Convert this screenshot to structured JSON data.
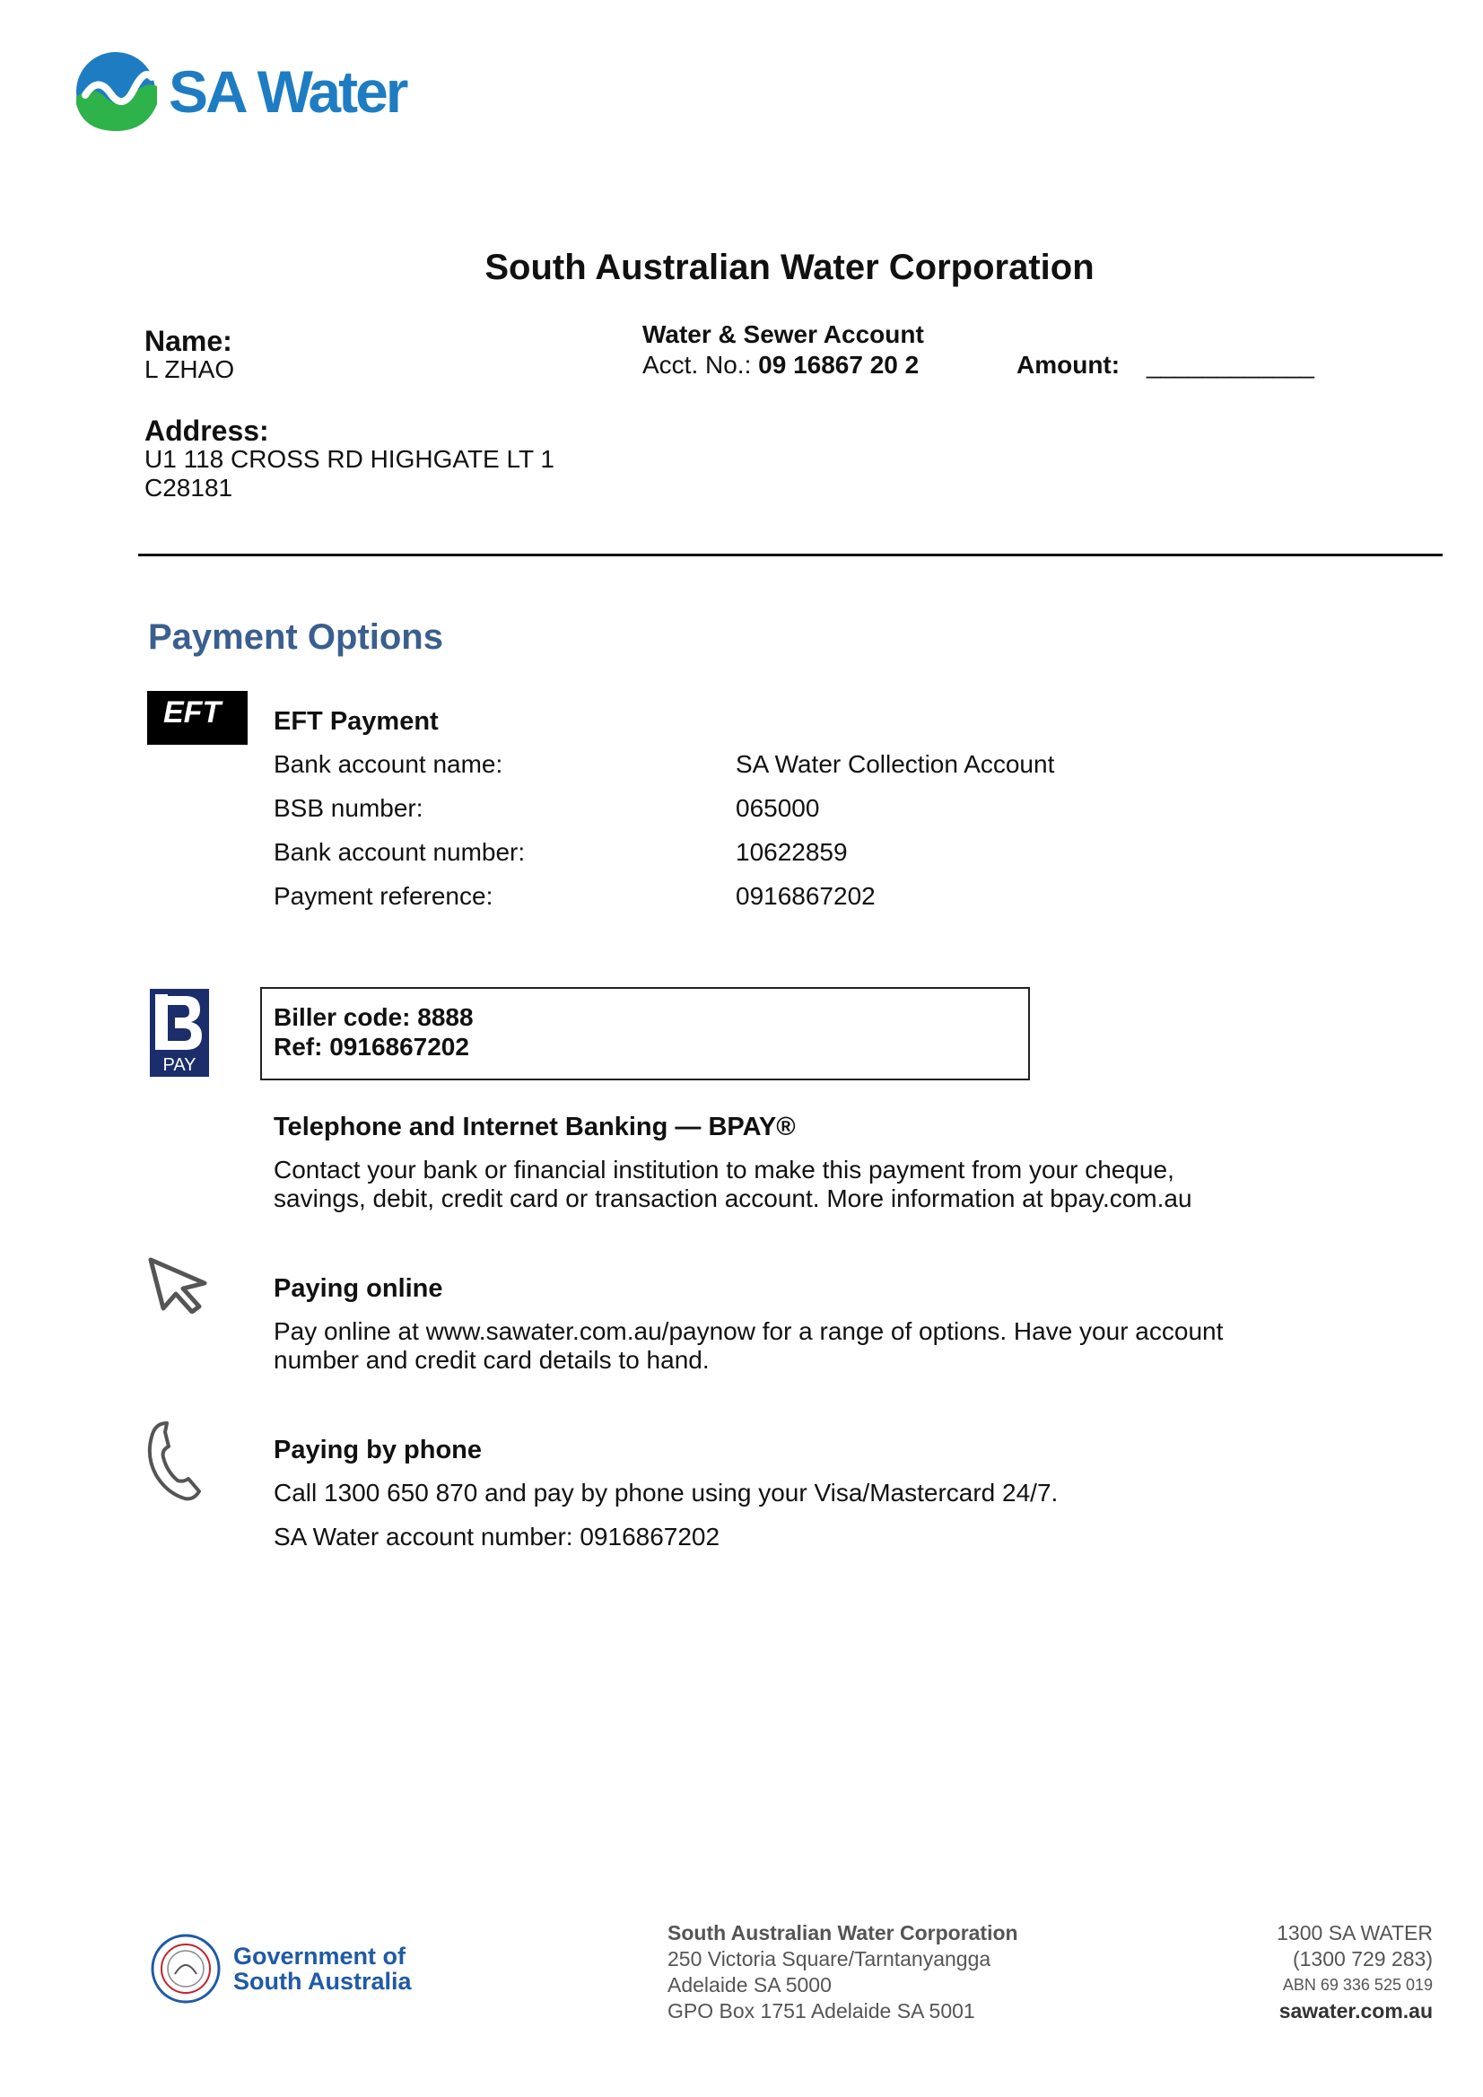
{
  "header": {
    "logo_text": "SA Water",
    "title": "South Australian Water Corporation"
  },
  "customer": {
    "name_label": "Name:",
    "name_value": "L ZHAO",
    "address_label": "Address:",
    "address_line1": "U1 118 CROSS RD HIGHGATE LT 1",
    "address_line2": "C28181"
  },
  "account": {
    "type": "Water & Sewer Account",
    "acct_label": "Acct. No.:",
    "acct_number": "09 16867 20 2",
    "amount_label": "Amount:",
    "amount_blank": "____________"
  },
  "payment": {
    "section_title": "Payment Options",
    "eft": {
      "badge": "EFT",
      "heading": "EFT Payment",
      "rows": [
        {
          "label": "Bank account name:",
          "value": "SA Water Collection Account"
        },
        {
          "label": "BSB number:",
          "value": "065000"
        },
        {
          "label": "Bank account number:",
          "value": "10622859"
        },
        {
          "label": "Payment reference:",
          "value": "0916867202"
        }
      ]
    },
    "bpay": {
      "logo_text": "PAY",
      "biller_code": "Biller code: 8888",
      "ref": "Ref: 0916867202",
      "heading": "Telephone and Internet Banking — BPAY®",
      "line1": "Contact your bank or financial institution to make this payment from your cheque,",
      "line2": "savings, debit, credit card or transaction account. More information at bpay.com.au"
    },
    "online": {
      "icon": "cursor-arrow-icon",
      "heading": "Paying online",
      "line1": "Pay online at www.sawater.com.au/paynow for a range of options. Have your account",
      "line2": "number and credit card details to hand."
    },
    "phone": {
      "icon": "phone-icon",
      "heading": "Paying by phone",
      "line1": "Call 1300 650 870 and pay by phone using your Visa/Mastercard 24/7.",
      "line2": "SA Water account number: 0916867202"
    }
  },
  "footer": {
    "gov_line1": "Government of",
    "gov_line2": "South Australia",
    "corp_name": "South Australian Water Corporation",
    "addr1": "250 Victoria Square/Tarntanyangga",
    "addr2": "Adelaide SA 5000",
    "addr3": "GPO Box 1751 Adelaide SA 5001",
    "phone_line1": "1300 SA WATER",
    "phone_line2": "(1300 729 283)",
    "abn": "ABN 69 336 525 019",
    "website": "sawater.com.au"
  },
  "colors": {
    "brand_blue": "#1e7dc2",
    "brand_green": "#2db34a",
    "heading_blue": "#3a5f8f",
    "bpay_navy": "#1b2e6b"
  }
}
